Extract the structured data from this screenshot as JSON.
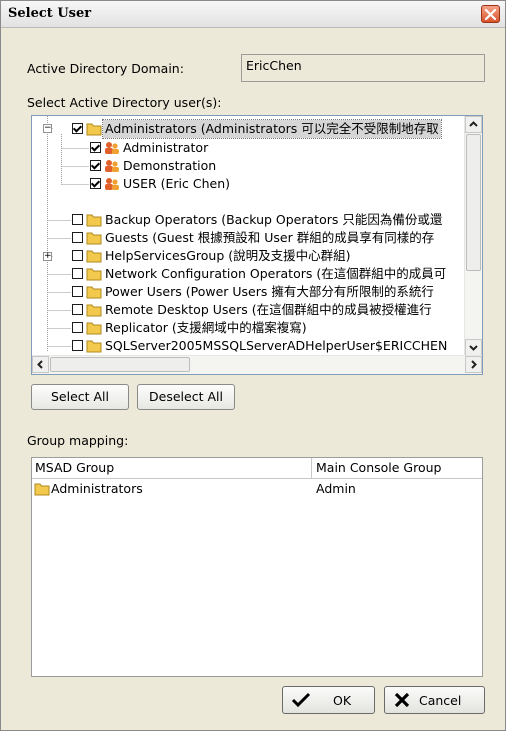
{
  "window": {
    "title": "Select User"
  },
  "domain": {
    "label": "Active Directory Domain:",
    "value": "EricChen"
  },
  "users_label": "Select Active Directory user(s):",
  "tree": {
    "nodes": [
      {
        "text": "Administrators (Administrators 可以完全不受限制地存取",
        "checked": true,
        "expander": "−"
      },
      {
        "text": "Administrator",
        "checked": true
      },
      {
        "text": "Demonstration",
        "checked": true
      },
      {
        "text": "USER (Eric Chen)",
        "checked": true
      },
      {
        "text": "Backup Operators (Backup Operators 只能因為備份或還",
        "checked": false
      },
      {
        "text": "Guests (Guest 根據預設和 User 群組的成員享有同樣的存",
        "checked": false
      },
      {
        "text": "HelpServicesGroup (說明及支援中心群組)",
        "checked": false,
        "expander": "+"
      },
      {
        "text": "Network Configuration Operators (在這個群組中的成員可",
        "checked": false
      },
      {
        "text": "Power Users (Power Users 擁有大部分有所限制的系統行",
        "checked": false
      },
      {
        "text": "Remote Desktop Users (在這個群組中的成員被授權進行",
        "checked": false
      },
      {
        "text": "Replicator (支援網域中的檔案複寫)",
        "checked": false
      },
      {
        "text": "SQLServer2005MSSQLServerADHelperUser$ERICCHEN",
        "checked": false
      }
    ]
  },
  "buttons": {
    "select_all": "Select All",
    "deselect_all": "Deselect All",
    "ok": "OK",
    "cancel": "Cancel"
  },
  "mapping": {
    "label": "Group mapping:",
    "columns": [
      "MSAD Group",
      "Main Console Group"
    ],
    "rows": [
      {
        "msad": "Administrators",
        "console": "Admin"
      }
    ]
  },
  "colors": {
    "close_button": "#d9542c",
    "folder": "#f2c94c",
    "user_icon": "#e0602b"
  }
}
